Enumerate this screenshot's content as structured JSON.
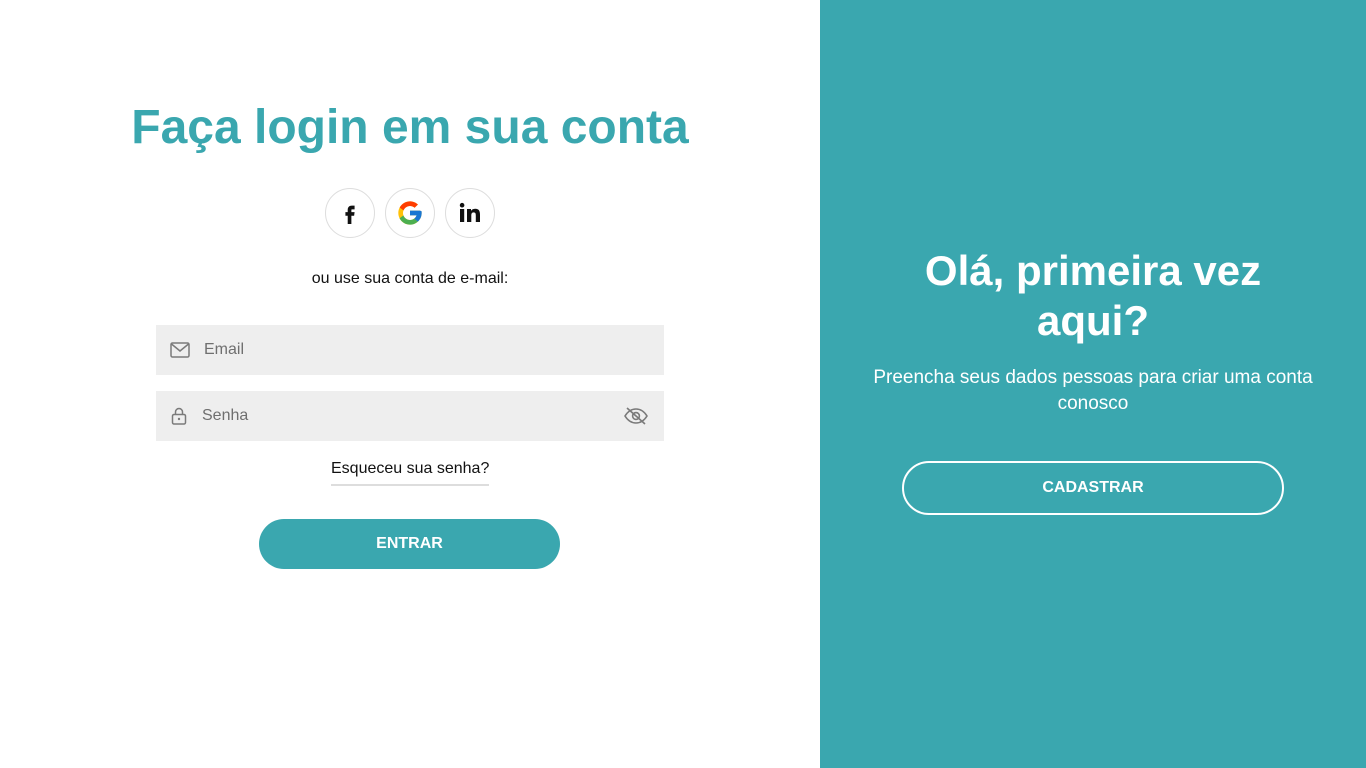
{
  "login": {
    "title": "Faça login em sua conta",
    "social": [
      {
        "name": "facebook-icon"
      },
      {
        "name": "google-icon"
      },
      {
        "name": "linkedin-icon"
      }
    ],
    "alt_text": "ou use sua conta de e-mail:",
    "email_placeholder": "Email",
    "password_placeholder": "Senha",
    "forgot_label": "Esqueceu sua senha?",
    "enter_label": "ENTRAR"
  },
  "register": {
    "title": "Olá, primeira vez aqui?",
    "subtitle": "Preencha seus dados pessoas para criar uma conta conosco",
    "button_label": "CADASTRAR"
  },
  "colors": {
    "accent": "#3aa7af",
    "field_bg": "#eeeeee",
    "white": "#ffffff"
  }
}
